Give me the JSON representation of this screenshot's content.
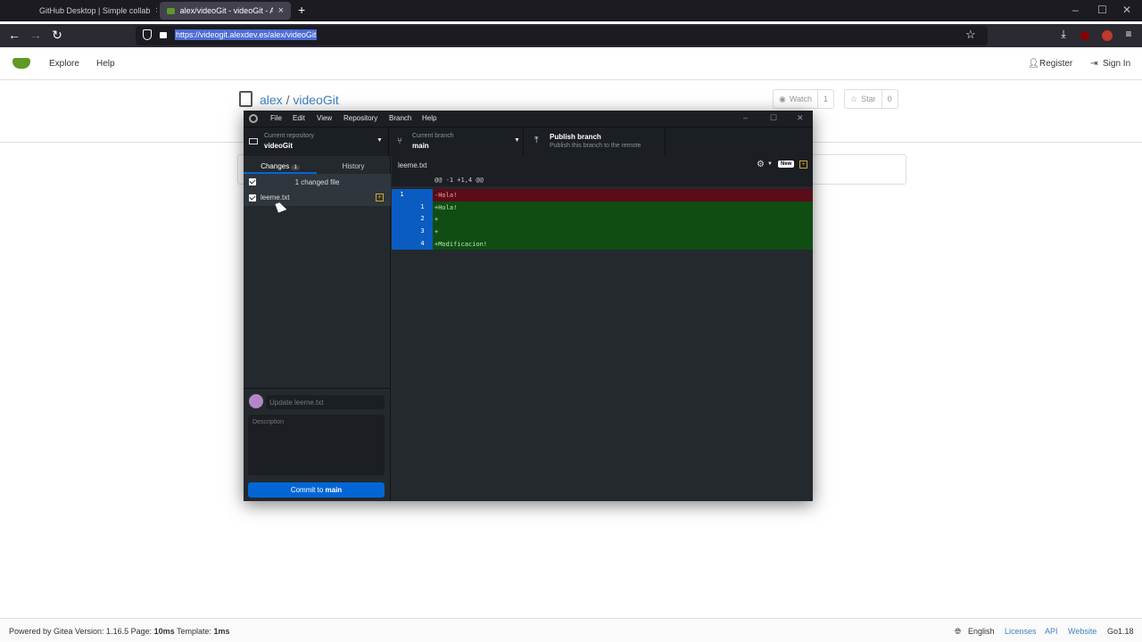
{
  "browser": {
    "tabs": [
      {
        "title": "GitHub Desktop | Simple collab"
      },
      {
        "title": "alex/videoGit - videoGit - Alex"
      }
    ],
    "new_tab": "+",
    "url": "https://videogit.alexdev.es/alex/videoGit"
  },
  "gitea": {
    "nav": {
      "explore": "Explore",
      "help": "Help",
      "register": "Register",
      "sign_in": "Sign In"
    },
    "repo": {
      "owner": "alex",
      "sep": "/",
      "name": "videoGit"
    },
    "watch": {
      "label": "Watch",
      "count": "1"
    },
    "star": {
      "label": "Star",
      "count": "0"
    },
    "footer": {
      "powered": "Powered by Gitea Version: 1.16.5 Page: ",
      "page_time": "10ms",
      "template_label": " Template: ",
      "template_time": "1ms",
      "language": "English",
      "licenses": "Licenses",
      "api": "API",
      "website": "Website",
      "go": "Go1.18"
    }
  },
  "desktop": {
    "menu": [
      "File",
      "Edit",
      "View",
      "Repository",
      "Branch",
      "Help"
    ],
    "current_repo_label": "Current repository",
    "current_repo": "videoGit",
    "current_branch_label": "Current branch",
    "current_branch": "main",
    "publish_title": "Publish branch",
    "publish_sub": "Publish this branch to the remote",
    "tabs": {
      "changes": "Changes",
      "changes_count": "1",
      "history": "History"
    },
    "changed_files": "1 changed file",
    "file": "leeme.txt",
    "diff_file": "leeme.txt",
    "new_badge": "New",
    "summary_placeholder": "Update leeme.txt",
    "description_placeholder": "Description",
    "commit_prefix": "Commit to ",
    "commit_branch": "main",
    "diff": {
      "hunk": "@@ -1 +1,4 @@",
      "lines": [
        {
          "old": "1",
          "new": "",
          "text": "-Hola!",
          "type": "del"
        },
        {
          "old": "",
          "new": "1",
          "text": "+Hola!",
          "type": "add"
        },
        {
          "old": "",
          "new": "2",
          "text": "+",
          "type": "add"
        },
        {
          "old": "",
          "new": "3",
          "text": "+",
          "type": "add"
        },
        {
          "old": "",
          "new": "4",
          "text": "+Modificacion!",
          "type": "add"
        }
      ]
    },
    "colors": {
      "del_bg": "#5c0b18",
      "add_bg": "#104d12",
      "gutter": "#0a5cc2"
    }
  }
}
